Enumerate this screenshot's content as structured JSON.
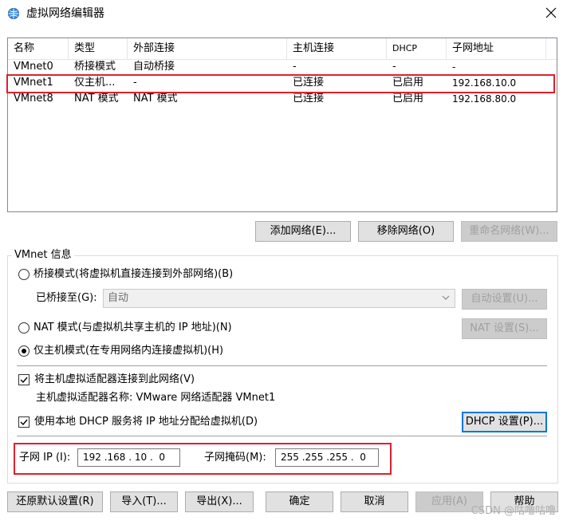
{
  "window": {
    "title": "虚拟网络编辑器",
    "close_glyph": "✕"
  },
  "list": {
    "columns": [
      "名称",
      "类型",
      "外部连接",
      "主机连接",
      "DHCP",
      "子网地址"
    ],
    "rows": [
      {
        "name": "VMnet0",
        "type": "桥接模式",
        "external": "自动桥接",
        "host": "-",
        "dhcp": "-",
        "subnet": "-"
      },
      {
        "name": "VMnet1",
        "type": "仅主机...",
        "external": "-",
        "host": "已连接",
        "dhcp": "已启用",
        "subnet": "192.168.10.0"
      },
      {
        "name": "VMnet8",
        "type": "NAT 模式",
        "external": "NAT 模式",
        "host": "已连接",
        "dhcp": "已启用",
        "subnet": "192.168.80.0"
      }
    ]
  },
  "list_buttons": {
    "add": "添加网络(E)...",
    "remove": "移除网络(O)",
    "rename": "重命名网络(W)..."
  },
  "vmnet_info": {
    "group_label": "VMnet 信息",
    "bridged_label": "桥接模式(将虚拟机直接连接到外部网络)(B)",
    "bridged_to_label": "已桥接至(G):",
    "bridged_to_value": "自动",
    "auto_settings": "自动设置(U)...",
    "nat_label": "NAT 模式(与虚拟机共享主机的 IP 地址)(N)",
    "nat_settings": "NAT 设置(S)...",
    "hostonly_label": "仅主机模式(在专用网络内连接虚拟机)(H)",
    "connect_adapter_label": "将主机虚拟适配器连接到此网络(V)",
    "adapter_name_label": "主机虚拟适配器名称: VMware 网络适配器 VMnet1",
    "use_dhcp_label": "使用本地 DHCP 服务将 IP 地址分配给虚拟机(D)",
    "dhcp_settings": "DHCP 设置(P)...",
    "subnet_ip_label": "子网 IP (I):",
    "subnet_ip_value": "192 .168 . 10 .  0",
    "subnet_mask_label": "子网掩码(M):",
    "subnet_mask_value": "255 .255 .255 .  0",
    "selected_mode": "host-only",
    "connect_adapter_checked": true,
    "use_dhcp_checked": true
  },
  "footer": {
    "restore": "还原默认设置(R)",
    "import": "导入(T)...",
    "export": "导出(X)...",
    "ok": "确定",
    "cancel": "取消",
    "apply": "应用(A)",
    "help": "帮助"
  },
  "watermark": "CSDN @咕噜咕噜",
  "colors": {
    "highlight_frame": "#e01f2c",
    "focus_border": "#0078d7"
  }
}
